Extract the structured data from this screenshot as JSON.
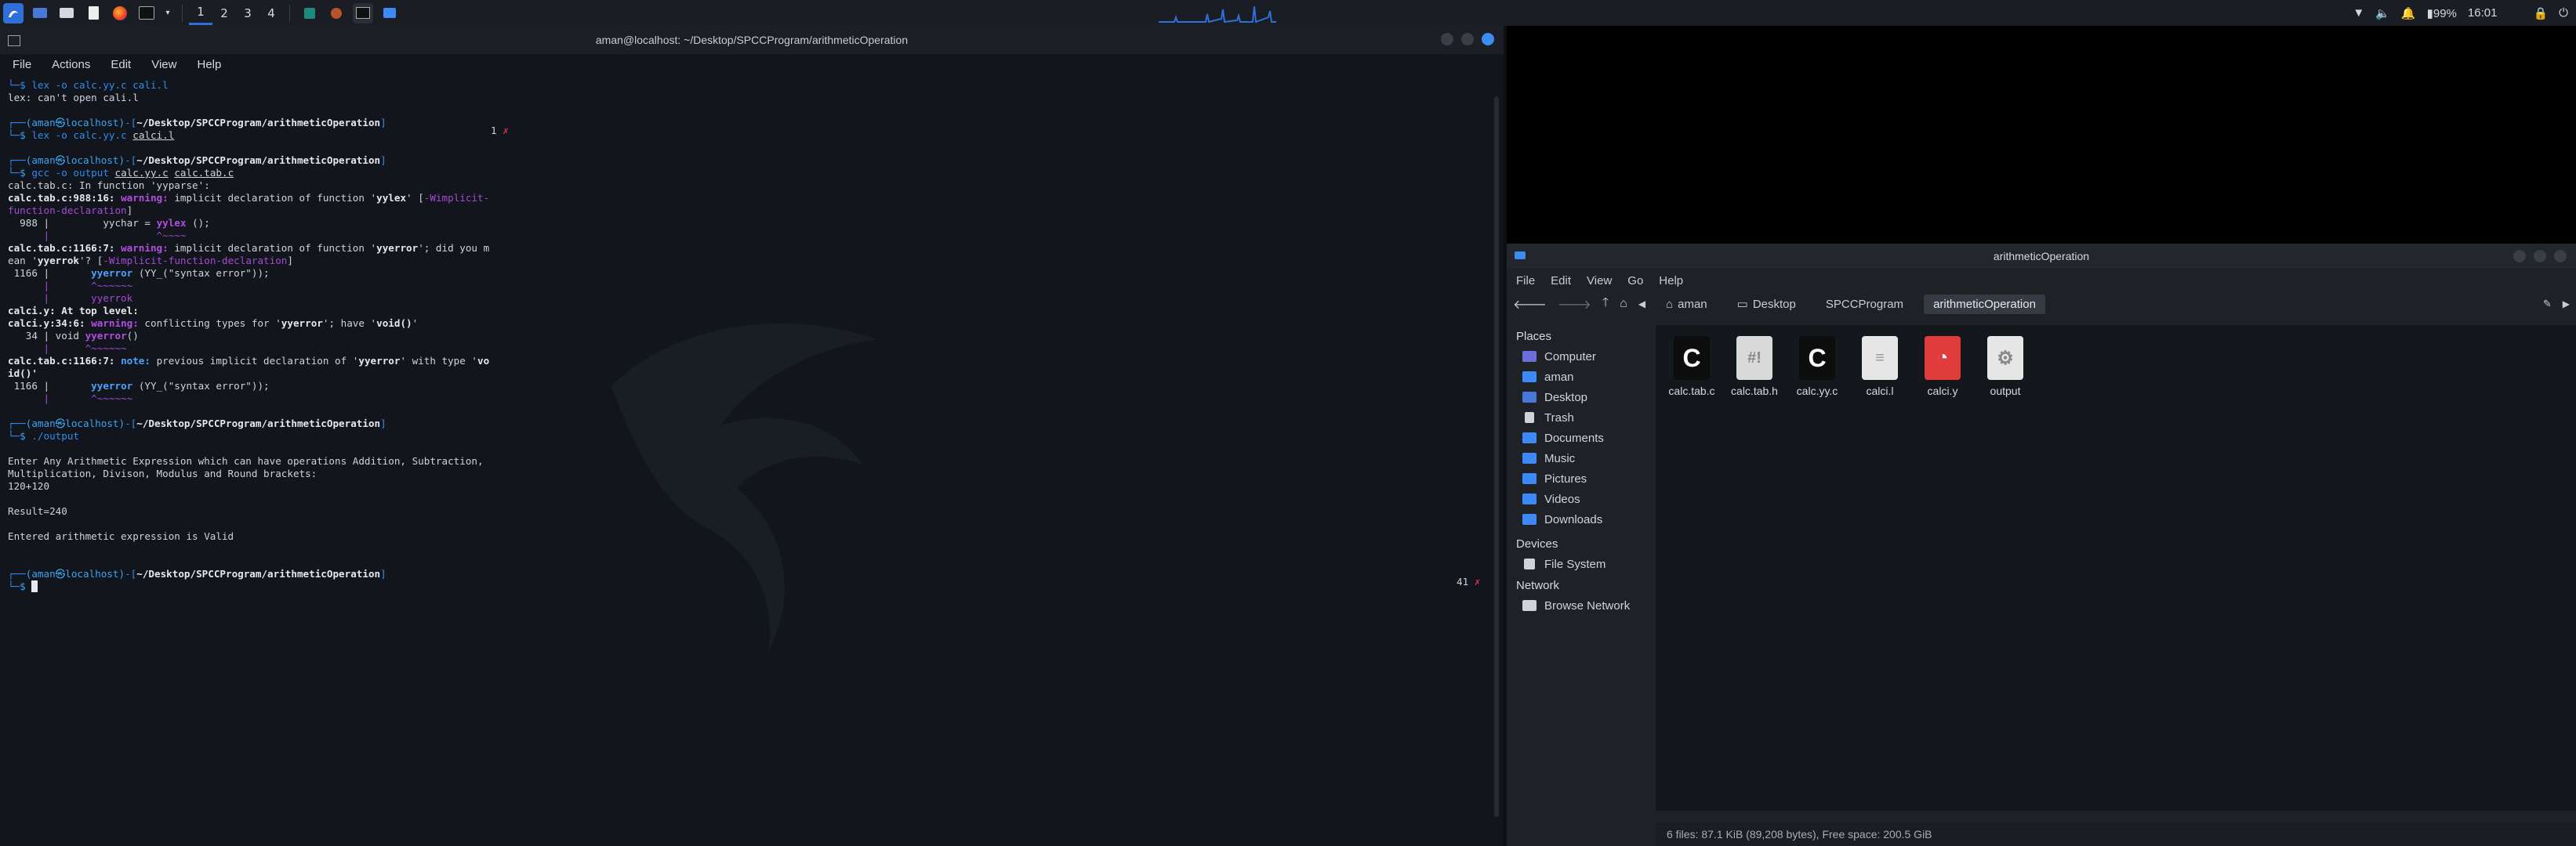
{
  "topbar": {
    "workspaces": [
      "1",
      "2",
      "3",
      "4"
    ],
    "battery": "99%",
    "clock": "16:01"
  },
  "terminal": {
    "title": "aman@localhost: ~/Desktop/SPCCProgram/arithmeticOperation",
    "menu": [
      "File",
      "Actions",
      "Edit",
      "View",
      "Help"
    ],
    "prompt_user": "(aman㉿localhost)",
    "prompt_path": "~/Desktop/SPCCProgram/arithmeticOperation",
    "lines": {
      "l0": "└─$ lex -o calc.yy.c cali.l",
      "l1": "lex: can't open cali.l",
      "c2": "lex -o calc.yy.c ",
      "c2u": "calci.l",
      "c3": "gcc -o output ",
      "c3a": "calc.yy.c",
      "c3b": "calc.tab.c",
      "w1": "calc.tab.c: In function 'yyparse':",
      "w2a": "calc.tab.c:988:16: ",
      "w2b": "warning: ",
      "w2c": "implicit declaration of function '",
      "w2d": "yylex",
      "w2e": "' [",
      "w2f": "-Wimplicit-",
      "w3": "function-declaration",
      "w3b": "]",
      "w4a": "  988 |         yychar = ",
      "w4b": "yylex",
      "w4c": " ();",
      "w5": "      |                  ^~~~~",
      "w6a": "calc.tab.c:1166:7: ",
      "w6b": "warning: ",
      "w6c": "implicit declaration of function '",
      "w6d": "yyerror",
      "w6e": "'; did you m",
      "w7a": "ean '",
      "w7b": "yyerrok",
      "w7c": "'? [",
      "w7d": "-Wimplicit-function-declaration",
      "w7e": "]",
      "w8a": " 1166 |       ",
      "w8b": "yyerror",
      "w8c": " (YY_(\"syntax error\"));",
      "w9": "      |       ^~~~~~~",
      "w10": "      |       yyerrok",
      "w11": "calci.y: At top level:",
      "w12a": "calci.y:34:6: ",
      "w12b": "warning: ",
      "w12c": "conflicting types for '",
      "w12d": "yyerror",
      "w12e": "'; have '",
      "w12f": "void()",
      "w12g": "'",
      "w13a": "   34 | void ",
      "w13b": "yyerror",
      "w13c": "()",
      "w14": "      |      ^~~~~~~",
      "w15a": "calc.tab.c:1166:7: ",
      "w15b": "note: ",
      "w15c": "previous implicit declaration of '",
      "w15d": "yyerror",
      "w15e": "' with type '",
      "w15f": "vo",
      "w16": "id()'",
      "w17a": " 1166 |       ",
      "w17b": "yyerror",
      "w17c": " (YY_(\"syntax error\"));",
      "w18": "      |       ^~~~~~~",
      "c4": "./output",
      "o1": "Enter Any Arithmetic Expression which can have operations Addition, Subtraction,",
      "o2": "Multiplication, Divison, Modulus and Round brackets:",
      "o3": "120+120",
      "o4": "Result=240",
      "o5": "Entered arithmetic expression is Valid"
    },
    "right_counts": [
      "1",
      "41"
    ]
  },
  "filemanager": {
    "title": "arithmeticOperation",
    "menu": [
      "File",
      "Edit",
      "View",
      "Go",
      "Help"
    ],
    "breadcrumbs": [
      "aman",
      "Desktop",
      "SPCCProgram",
      "arithmeticOperation"
    ],
    "places_header": "Places",
    "places": [
      "Computer",
      "aman",
      "Desktop",
      "Trash",
      "Documents",
      "Music",
      "Pictures",
      "Videos",
      "Downloads"
    ],
    "devices_header": "Devices",
    "devices": [
      "File System"
    ],
    "network_header": "Network",
    "network": [
      "Browse Network"
    ],
    "files": [
      "calc.tab.c",
      "calc.tab.h",
      "calc.yy.c",
      "calci.l",
      "calci.y",
      "output"
    ],
    "status": "6 files: 87.1 KiB (89,208 bytes), Free space: 200.5 GiB"
  }
}
